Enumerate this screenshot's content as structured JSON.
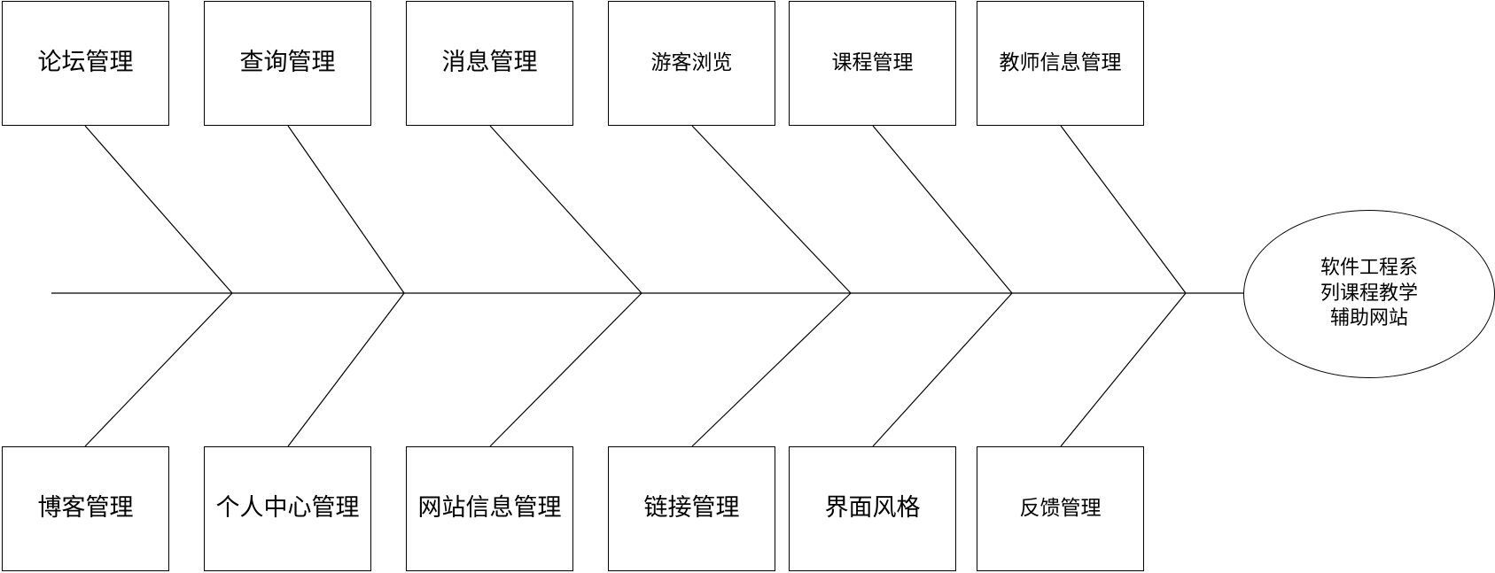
{
  "diagram": {
    "type": "fishbone",
    "effect": {
      "lines": [
        "软件工程系",
        "列课程教学",
        "辅助网站"
      ]
    },
    "top_causes": [
      {
        "label": "论坛管理"
      },
      {
        "label": "查询管理"
      },
      {
        "label": "消息管理"
      },
      {
        "label": "游客浏览"
      },
      {
        "label": "课程管理"
      },
      {
        "label": "教师信息管理"
      }
    ],
    "bottom_causes": [
      {
        "label": "博客管理"
      },
      {
        "label": "个人中心管理"
      },
      {
        "label": "网站信息管理"
      },
      {
        "label": "链接管理"
      },
      {
        "label": "界面风格"
      },
      {
        "label": "反馈管理"
      }
    ],
    "line_color": "#000000",
    "background_color": "#ffffff"
  }
}
